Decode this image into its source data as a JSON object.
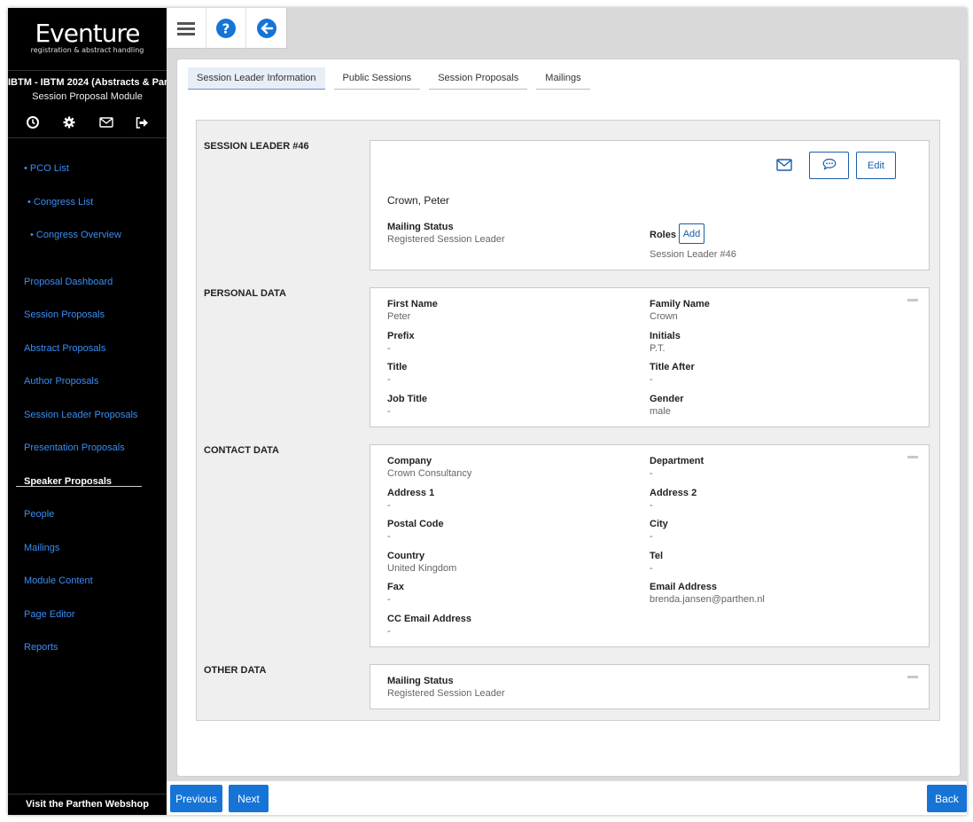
{
  "sidebar": {
    "brand": "Eventure",
    "tagline": "registration & abstract handling",
    "congress": "IBTM - IBTM 2024 (Abstracts & Par...",
    "module": "Session Proposal Module",
    "icons": [
      "clock-icon",
      "gear-icon",
      "mail-icon",
      "logout-icon"
    ],
    "nav": {
      "pco_list": "• PCO List",
      "congress_list": "• Congress List",
      "congress_overview": "• Congress Overview",
      "proposal_dashboard": "Proposal Dashboard",
      "session_proposals": "Session Proposals",
      "abstract_proposals": "Abstract Proposals",
      "author_proposals": "Author Proposals",
      "session_leader_proposals": "Session Leader Proposals",
      "presentation_proposals": "Presentation Proposals",
      "speaker_proposals": "Speaker Proposals",
      "people": "People",
      "mailings": "Mailings",
      "module_content": "Module Content",
      "page_editor": "Page Editor",
      "reports": "Reports"
    },
    "webshop": "Visit the Parthen Webshop"
  },
  "toolbar": {
    "icons": [
      "menu-icon",
      "help-icon",
      "back-arrow-icon"
    ]
  },
  "tabs": {
    "leader_info": "Session Leader Information",
    "public_sessions": "Public Sessions",
    "session_proposals": "Session Proposals",
    "mailings": "Mailings"
  },
  "leader": {
    "section": "SESSION LEADER #46",
    "name": "Crown, Peter",
    "edit_label": "Edit",
    "mailing_status_label": "Mailing Status",
    "mailing_status_value": "Registered Session Leader",
    "roles_label": "Roles",
    "add_label": "Add",
    "role_value": "Session Leader #46"
  },
  "personal": {
    "section": "PERSONAL DATA",
    "first_name_label": "First Name",
    "first_name": "Peter",
    "family_name_label": "Family Name",
    "family_name": "Crown",
    "prefix_label": "Prefix",
    "prefix": "-",
    "initials_label": "Initials",
    "initials": "P.T.",
    "title_label": "Title",
    "title": "-",
    "title_after_label": "Title After",
    "title_after": "-",
    "job_title_label": "Job Title",
    "job_title": "-",
    "gender_label": "Gender",
    "gender": "male"
  },
  "contact": {
    "section": "CONTACT DATA",
    "company_label": "Company",
    "company": "Crown Consultancy",
    "department_label": "Department",
    "department": "-",
    "address1_label": "Address 1",
    "address1": "-",
    "address2_label": "Address 2",
    "address2": "-",
    "postal_label": "Postal Code",
    "postal": "-",
    "city_label": "City",
    "city": "-",
    "country_label": "Country",
    "country": "United Kingdom",
    "tel_label": "Tel",
    "tel": "-",
    "fax_label": "Fax",
    "fax": "-",
    "email_label": "Email Address",
    "email": "brenda.jansen@parthen.nl",
    "cc_email_label": "CC Email Address",
    "cc_email": "-"
  },
  "other": {
    "section": "OTHER DATA",
    "mailing_status_label": "Mailing Status",
    "mailing_status_value": "Registered Session Leader"
  },
  "footer": {
    "previous": "Previous",
    "next": "Next",
    "back": "Back"
  },
  "colors": {
    "sidebar_bg": "#000000",
    "link": "#3a8ef5",
    "primary": "#1674d6",
    "outline": "#1a5fa8"
  }
}
